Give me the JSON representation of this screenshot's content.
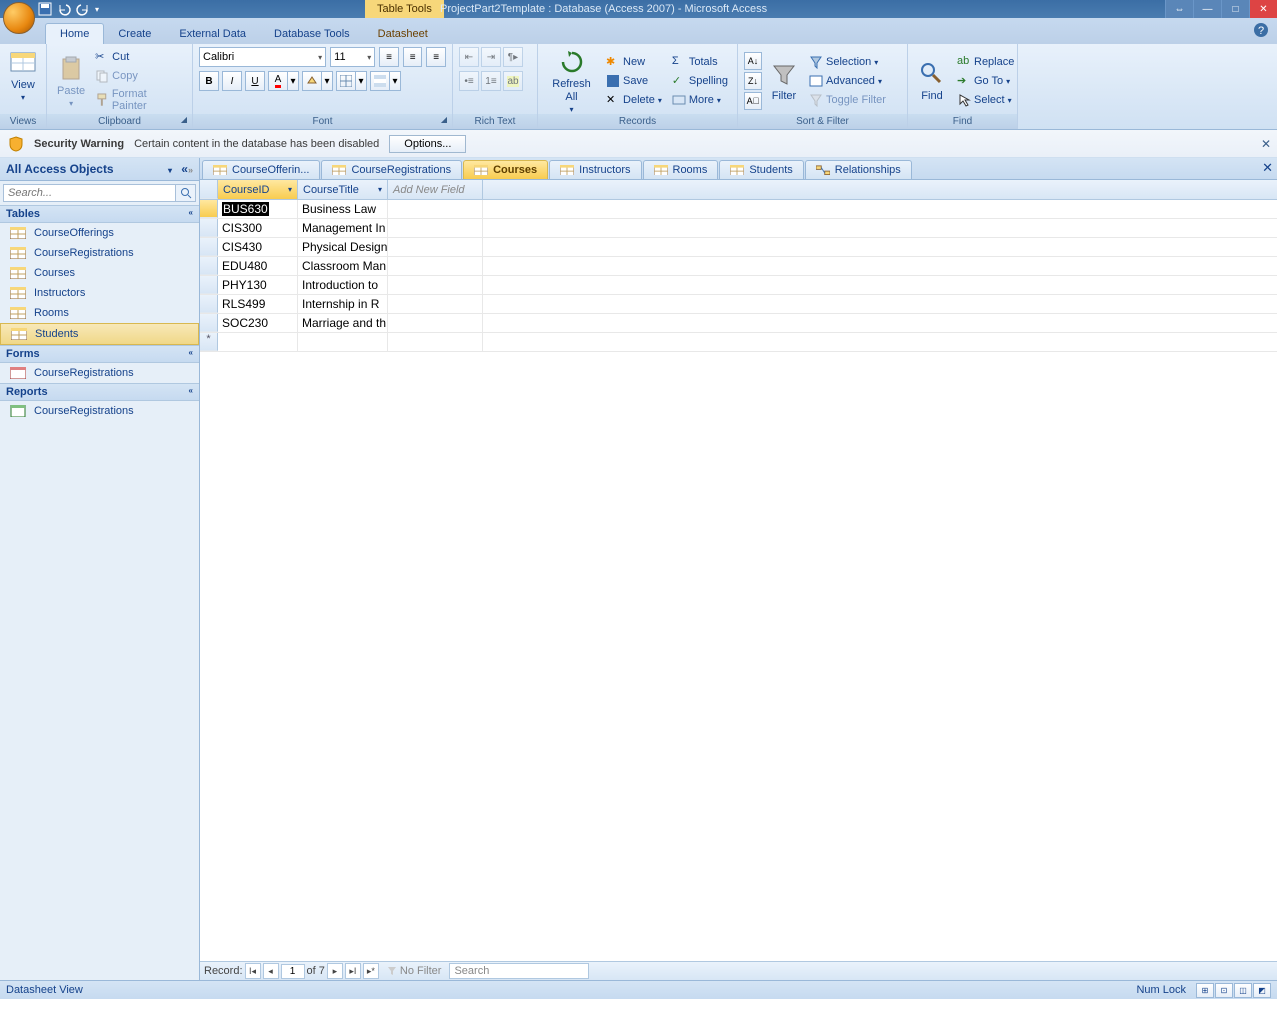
{
  "title": {
    "tools_context": "Table Tools",
    "document": "ProjectPart2Template : Database (Access 2007) - Microsoft Access"
  },
  "ribbon_tabs": {
    "home": "Home",
    "create": "Create",
    "external": "External Data",
    "dbtools": "Database Tools",
    "datasheet": "Datasheet"
  },
  "ribbon": {
    "views": {
      "label": "Views",
      "view": "View"
    },
    "clipboard": {
      "label": "Clipboard",
      "paste": "Paste",
      "cut": "Cut",
      "copy": "Copy",
      "fmt": "Format Painter"
    },
    "font": {
      "label": "Font",
      "name": "Calibri",
      "size": "11"
    },
    "richtext": {
      "label": "Rich Text"
    },
    "records": {
      "label": "Records",
      "refresh": "Refresh All",
      "new": "New",
      "save": "Save",
      "delete": "Delete",
      "totals": "Totals",
      "spelling": "Spelling",
      "more": "More"
    },
    "sortfilter": {
      "label": "Sort & Filter",
      "filter": "Filter",
      "selection": "Selection",
      "advanced": "Advanced",
      "toggle": "Toggle Filter"
    },
    "find": {
      "label": "Find",
      "find": "Find",
      "replace": "Replace",
      "goto": "Go To",
      "select": "Select"
    }
  },
  "security": {
    "title": "Security Warning",
    "msg": "Certain content in the database has been disabled",
    "btn": "Options..."
  },
  "nav": {
    "title": "All Access Objects",
    "search_placeholder": "Search...",
    "groups": {
      "tables": "Tables",
      "forms": "Forms",
      "reports": "Reports"
    },
    "tables": [
      "CourseOfferings",
      "CourseRegistrations",
      "Courses",
      "Instructors",
      "Rooms",
      "Students"
    ],
    "forms": [
      "CourseRegistrations"
    ],
    "reports": [
      "CourseRegistrations"
    ],
    "selected": "Students"
  },
  "doctabs": [
    "CourseOfferin...",
    "CourseRegistrations",
    "Courses",
    "Instructors",
    "Rooms",
    "Students",
    "Relationships"
  ],
  "doctab_active": "Courses",
  "datasheet": {
    "columns": {
      "id": "CourseID",
      "title": "CourseTitle",
      "addnew": "Add New Field"
    },
    "rows": [
      {
        "id": "BUS630",
        "title": "Business Law"
      },
      {
        "id": "CIS300",
        "title": "Management In"
      },
      {
        "id": "CIS430",
        "title": "Physical Design"
      },
      {
        "id": "EDU480",
        "title": "Classroom Man"
      },
      {
        "id": "PHY130",
        "title": "Introduction to"
      },
      {
        "id": "RLS499",
        "title": "Internship in R"
      },
      {
        "id": "SOC230",
        "title": "Marriage and th"
      }
    ]
  },
  "recordnav": {
    "label": "Record:",
    "pos": "1",
    "total": "of 7",
    "nofilter": "No Filter",
    "search": "Search"
  },
  "status": {
    "view": "Datasheet View",
    "numlock": "Num Lock"
  }
}
